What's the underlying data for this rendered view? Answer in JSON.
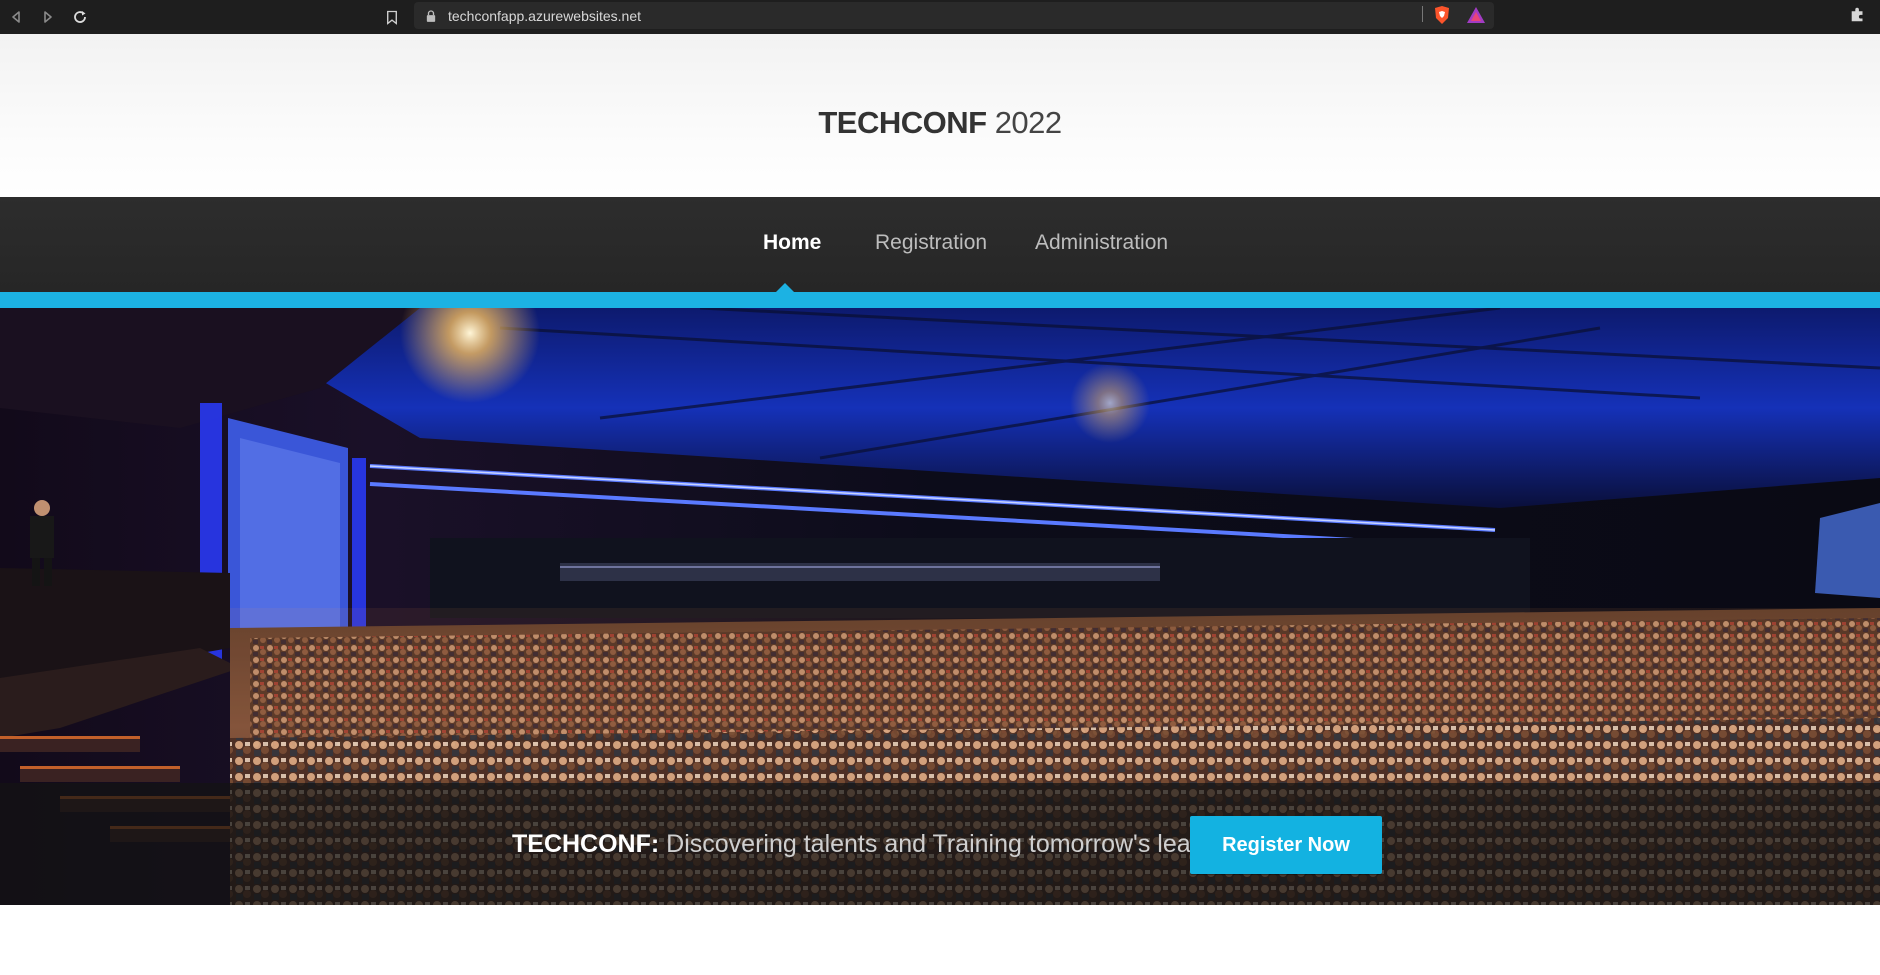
{
  "browser": {
    "url": "techconfapp.azurewebsites.net",
    "icons": [
      "back-icon",
      "forward-icon",
      "reload-icon",
      "bookmark-icon",
      "lock-icon",
      "brave-shield-icon",
      "brave-rewards-icon",
      "extensions-icon"
    ]
  },
  "header": {
    "logo_brand": "TECHCONF",
    "logo_year": "2022"
  },
  "nav": {
    "items": [
      {
        "label": "Home",
        "active": true
      },
      {
        "label": "Registration",
        "active": false
      },
      {
        "label": "Administration",
        "active": false
      }
    ]
  },
  "hero": {
    "tagline_brand": "TECHCONF:",
    "tagline_text": "Discovering talents and Training tomorrow's leaders",
    "cta_label": "Register Now"
  },
  "colors": {
    "accent": "#1cb2e3",
    "nav_background": "#2a2a2a",
    "browser_bar": "#1e1e1e"
  }
}
